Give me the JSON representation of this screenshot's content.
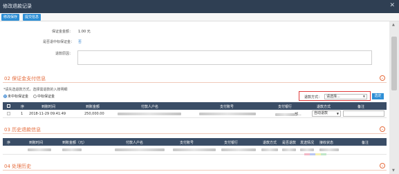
{
  "window": {
    "title": "修改退款记录",
    "close_glyph": "✕"
  },
  "toolbar": {
    "save_label": "修改保存",
    "submit_label": "提交信息"
  },
  "form": {
    "deposit_label": "保证金金额：",
    "deposit_value": "1.00 元",
    "winning_label": "是否退中标保证金：",
    "winning_value": "否",
    "reason_label": "退款原因："
  },
  "section_payment": {
    "title": "02 保证金支付信息"
  },
  "payment": {
    "hint": "*请先选退款方式，选择需退款的入账明细",
    "radio_options": [
      {
        "label": "未中标保证金",
        "selected": true
      },
      {
        "label": "中标保证金",
        "selected": false
      }
    ],
    "refund_method_label": "退款方式：",
    "refund_method_placeholder": "请选择...",
    "query_label": "选定",
    "headers": [
      "序",
      "到账时间",
      "到账金额",
      "付款人户名",
      "支付账号",
      "支付银行",
      "退款方式",
      "备注"
    ],
    "rows": [
      {
        "index": "1",
        "time": "2018-11-29 09:41:49",
        "amount": "250,000.00",
        "bank_suffix": "部...",
        "method": "自动退款"
      }
    ]
  },
  "section_history": {
    "title": "03 历史退款信息"
  },
  "history": {
    "headers": [
      "序",
      "到账时间",
      "到账金额（元）",
      "付款人户名",
      "支付账号",
      "支付银行",
      "退款方式",
      "是否退款",
      "发送情况",
      "接收状态",
      "备注"
    ]
  },
  "section_process": {
    "title": "04 处理历史"
  },
  "colors": {
    "accent": "#2e8fd6",
    "section": "#e56b3b",
    "header": "#3a4d66",
    "highlight": "#e03a3a"
  },
  "icons": {
    "chevron": "chevron-down-icon",
    "close": "close-icon"
  }
}
